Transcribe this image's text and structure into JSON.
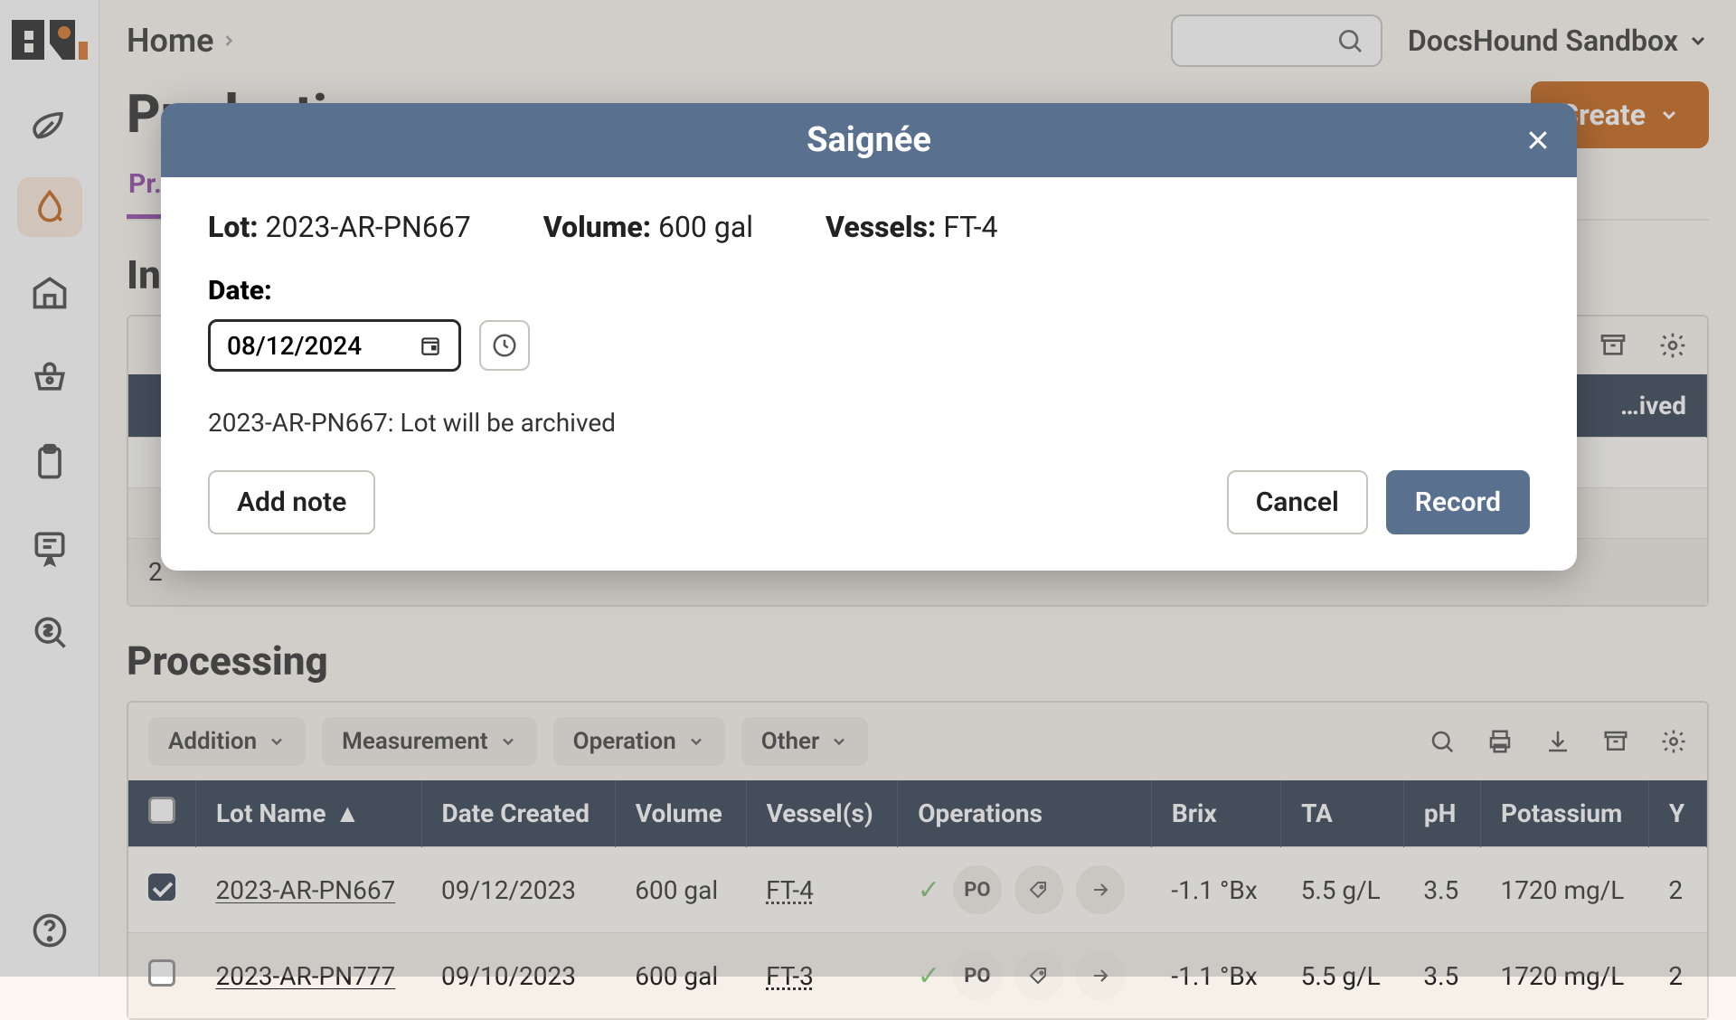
{
  "breadcrumb": {
    "home": "Home"
  },
  "workspace": {
    "name": "DocsHound Sandbox"
  },
  "page": {
    "title": "Production",
    "create": "Create"
  },
  "tabs": {
    "active": "Pr…"
  },
  "sections": {
    "in": "In",
    "processing": "Processing"
  },
  "toolbar": {
    "addition": "Addition",
    "measurement": "Measurement",
    "operation": "Operation",
    "other": "Other"
  },
  "columns": {
    "lot": "Lot Name",
    "date": "Date Created",
    "volume": "Volume",
    "vessels": "Vessel(s)",
    "operations": "Operations",
    "brix": "Brix",
    "ta": "TA",
    "ph": "pH",
    "potassium": "Potassium",
    "extra": "Y"
  },
  "rows": [
    {
      "checked": true,
      "lot": "2023-AR-PN667",
      "date": "09/12/2023",
      "volume": "600 gal",
      "vessel": "FT-4",
      "op_badge": "PO",
      "brix": "-1.1 °Bx",
      "ta": "5.5 g/L",
      "ph": "3.5",
      "potassium": "1720 mg/L",
      "extra": "2"
    },
    {
      "checked": false,
      "lot": "2023-AR-PN777",
      "date": "09/10/2023",
      "volume": "600 gal",
      "vessel": "FT-3",
      "op_badge": "PO",
      "brix": "-1.1 °Bx",
      "ta": "5.5 g/L",
      "ph": "3.5",
      "potassium": "1720 mg/L",
      "extra": "2"
    }
  ],
  "hidden_row_status": "…ived",
  "footer_row_prefix": "2",
  "modal": {
    "title": "Saignée",
    "lot_label": "Lot:",
    "lot_value": "2023-AR-PN667",
    "volume_label": "Volume:",
    "volume_value": "600 gal",
    "vessels_label": "Vessels:",
    "vessels_value": "FT-4",
    "date_label": "Date:",
    "date_value": "08/12/2024",
    "warning": "2023-AR-PN667: Lot will be archived",
    "add_note": "Add note",
    "cancel": "Cancel",
    "record": "Record"
  }
}
